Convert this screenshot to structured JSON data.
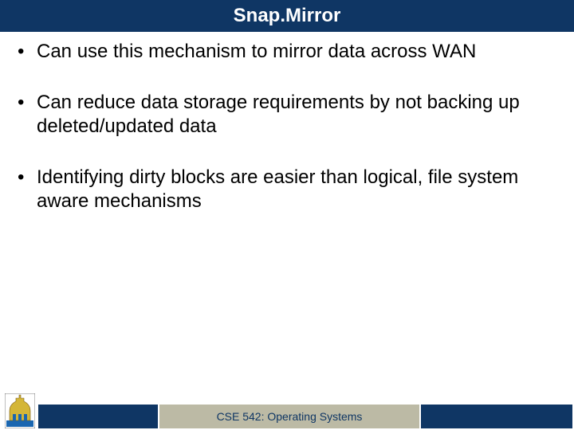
{
  "title": "Snap.Mirror",
  "bullets": [
    "Can use this mechanism to mirror data across WAN",
    "Can reduce data storage requirements by not backing up deleted/updated data",
    "Identifying dirty blocks are easier than logical, file system aware mechanisms"
  ],
  "footer": {
    "course": "CSE 542: Operating Systems"
  },
  "colors": {
    "navy": "#0f3664",
    "tan": "#bcbaa5"
  }
}
